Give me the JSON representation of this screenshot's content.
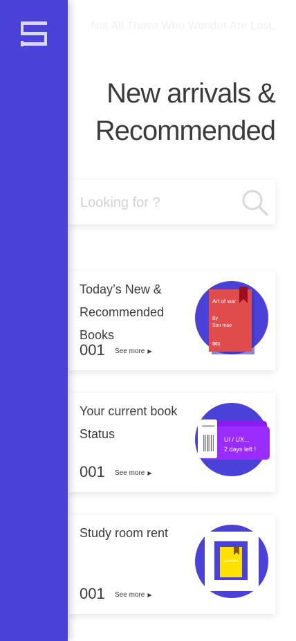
{
  "header": {
    "tagline": "Not All Those Who Wonder Are Lost.",
    "title_line1": "New arrivals &",
    "title_line2": "Recommended"
  },
  "search": {
    "placeholder": "Looking for ?"
  },
  "cards": [
    {
      "title": "Today’s New & Recommended Books",
      "count": "001",
      "see_more": "See more",
      "art": {
        "book_title": "Art of war",
        "by": "By",
        "author": "Son mao",
        "code": "001"
      }
    },
    {
      "title": "Your current book Status",
      "count": "001",
      "see_more": "See more",
      "art": {
        "line1": "UI / UX...",
        "line2": "2 days left !"
      }
    },
    {
      "title": "Study room rent",
      "count": "001",
      "see_more": "See more",
      "art": {
        "label": "Available"
      }
    }
  ],
  "colors": {
    "sidebar": "#4a41d8",
    "circle": "#4a41d8",
    "book_red": "#e04b4b",
    "bookmark": "#9a1020",
    "ticket_purple": "#8a1cf0",
    "room_yellow": "#ffe100"
  },
  "icons": {
    "menu": "menu-icon",
    "search": "search-icon"
  }
}
